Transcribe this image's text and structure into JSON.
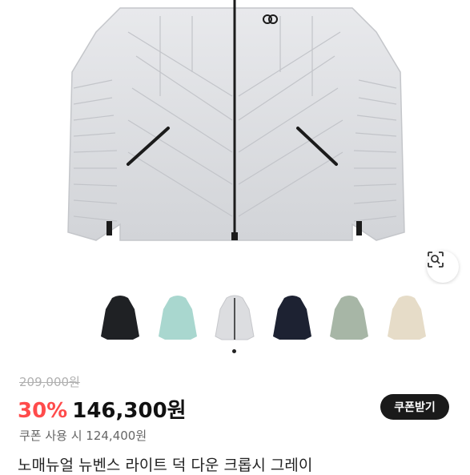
{
  "product": {
    "title": "노매뉴얼 뉴벤스 라이트 덕 다운 크롭시 그레이",
    "original_price": "209,000원",
    "discount_rate": "30%",
    "sale_price": "146,300원",
    "coupon_note": "쿠폰 사용 시 124,400원",
    "coupon_button_label": "쿠폰받기",
    "selected_color_index": 2
  },
  "color_options": [
    {
      "name": "black",
      "color": "#1f2124"
    },
    {
      "name": "mint",
      "color": "#a9d7cf"
    },
    {
      "name": "light-grey",
      "color": "#dcdde0"
    },
    {
      "name": "navy",
      "color": "#1d2232"
    },
    {
      "name": "sage",
      "color": "#a7b6a6"
    },
    {
      "name": "beige",
      "color": "#e6dcc8"
    }
  ],
  "icons": {
    "lens": "lens-search-icon",
    "brand": "brand-logo-icon"
  },
  "colors": {
    "accent": "#ff4b4b",
    "button": "#1a1a1a",
    "jacket": "#dcdde1"
  }
}
